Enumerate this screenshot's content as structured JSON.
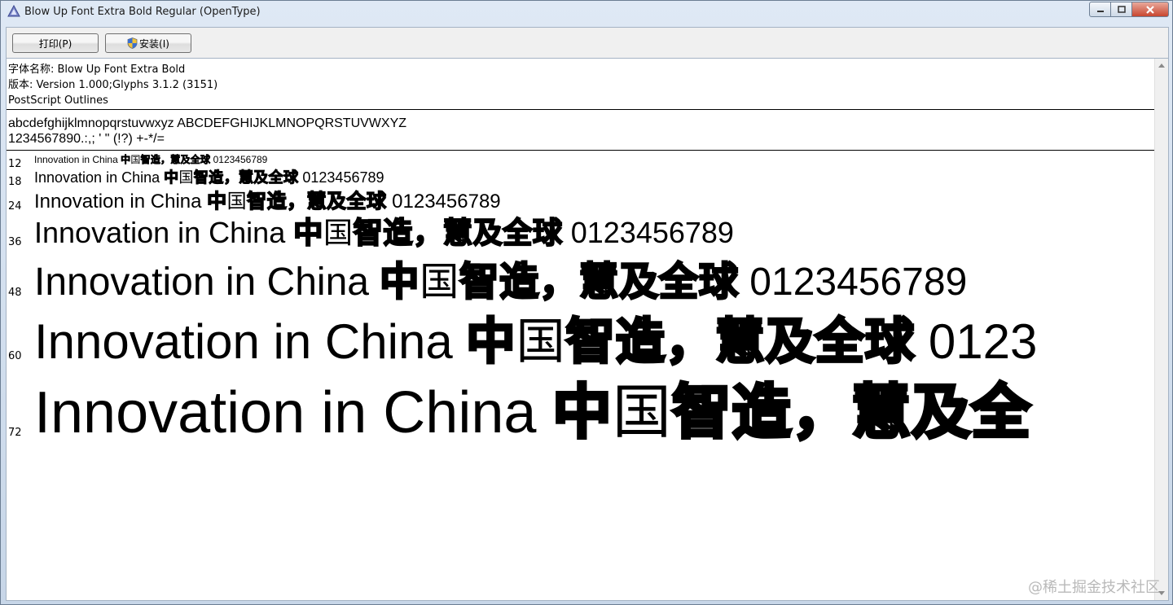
{
  "window": {
    "title": "Blow Up Font Extra Bold Regular (OpenType)",
    "controls": [
      "minimize",
      "maximize",
      "close"
    ]
  },
  "toolbar": {
    "print_label": "打印(P)",
    "install_label": "安装(I)"
  },
  "font_info": {
    "name_line": "字体名称: Blow Up Font Extra Bold",
    "version_line": "版本: Version 1.000;Glyphs 3.1.2 (3151)",
    "outline_line": "PostScript Outlines"
  },
  "charset": {
    "letters": "abcdefghijklmnopqrstuvwxyz ABCDEFGHIJKLMNOPQRSTUVWXYZ",
    "digits_punct": "1234567890.:,; ' \" (!?) +-*/="
  },
  "samples": [
    {
      "size": "12",
      "latin": "Innovation in China",
      "cn1": "中",
      "cn2": "国",
      "cn3": "智造，慧及全球",
      "digits": "0123456789"
    },
    {
      "size": "18",
      "latin": "Innovation in China",
      "cn1": "中",
      "cn2": "国",
      "cn3": "智造，慧及全球",
      "digits": "0123456789"
    },
    {
      "size": "24",
      "latin": "Innovation in China",
      "cn1": "中",
      "cn2": "国",
      "cn3": "智造，慧及全球",
      "digits": "0123456789"
    },
    {
      "size": "36",
      "latin": "Innovation in China",
      "cn1": "中",
      "cn2": "国",
      "cn3": "智造，慧及全球",
      "digits": "0123456789"
    },
    {
      "size": "48",
      "latin": "Innovation in China",
      "cn1": "中",
      "cn2": "国",
      "cn3": "智造，慧及全球",
      "digits": "0123456789"
    },
    {
      "size": "60",
      "latin": "Innovation in China",
      "cn1": "中",
      "cn2": "国",
      "cn3": "智造，慧及全球",
      "digits": "0123"
    },
    {
      "size": "72",
      "latin": "Innovation in China",
      "cn1": "中",
      "cn2": "国",
      "cn3": "智造，慧及全",
      "digits": ""
    }
  ],
  "watermark": "@稀土掘金技术社区"
}
